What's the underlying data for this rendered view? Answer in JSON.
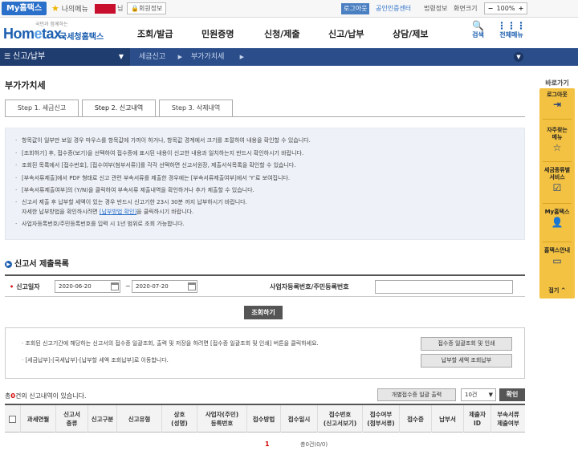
{
  "util": {
    "home_tab": "My홈택스",
    "mymenu": "나의메뉴",
    "nim": "님",
    "member_info": "회원정보",
    "logout": "로그아웃",
    "cert_center": "공인인증센터",
    "law_info": "법령정보",
    "screen_size": "화면크기",
    "zoom_minus": "−",
    "zoom_value": "100%",
    "zoom_plus": "+"
  },
  "header": {
    "logo_tagline": "국민과 함께하는",
    "logo_text_a": "Hom",
    "logo_text_b": "e",
    "logo_text_c": "tax.",
    "logo_agency": "국세청홈택스",
    "nav": [
      "조회/발급",
      "민원증명",
      "신청/제출",
      "신고/납부",
      "상담/제보"
    ],
    "search": "검색",
    "all_menu": "전체메뉴"
  },
  "navbar": {
    "current": "신고/납부",
    "crumb1": "세금신고",
    "crumb2": "부가가치세"
  },
  "page": {
    "title": "부가가치세",
    "tabs": [
      "Step 1. 세금신고",
      "Step 2. 신고내역",
      "Step 3. 삭제내역"
    ],
    "active_tab": 1
  },
  "notice": {
    "lines": [
      "항목값이 일부만 보일 경우 마우스를 항목값에 가까이 하거나, 항목값 경계에서 크기를 조절하여 내용을 확인할 수 있습니다.",
      "[조회하기] 후, 접수증(보기)을 선택하여 접수증에 표시된 내용이 신고한 내용과 일치하는지 반드시 확인하시기 바랍니다.",
      "조회된 목록에서 [접수번호], [접수여부(첨부서류)]를 각각 선택하면 신고서원장, 제출서식목록을 확인할 수 있습니다.",
      "[부속서류제출]에서 PDF 형태로 신고 관련 부속서류를 제출한 경우에는 [부속서류제출여부]에서 'Y'로 보여집니다.",
      "[부속서류제출여부]의 (Y/N)을 클릭하여 부속서류 제출내역을 확인하거나 추가 제출할 수 있습니다.",
      "신고서 제출 후 납부할 세액이 있는 경우 반드시 신고기한 23시 30분 까지 납부하시기 바랍니다."
    ],
    "cont_prefix": "자세한 납부방법을 확인하시려면 ",
    "cont_link": "[납부방법 확인]",
    "cont_suffix": "을 클릭하시기 바랍니다.",
    "last_line": "사업자등록번호/주민등록번호를 입력 시 1년 범위로 조회 가능합니다."
  },
  "section": {
    "title": "신고서 제출목록"
  },
  "search": {
    "date_label": "신고일자",
    "date_from": "2020-06-20",
    "date_to": "2020-07-20",
    "tilde": "~",
    "biz_label": "사업자등록번호/주민등록번호",
    "biz_value": "",
    "query_button": "조회하기"
  },
  "notice2": {
    "line1": "· 조회된 신고기간에 해당하는 신고서의 접수증 일괄조회, 출력 및 저장을 하려면 [접수증 일괄조회 및 인쇄] 버튼을 클릭하세요.",
    "line2": "· [세금납부]-[국세납부]-[납부할 세액 조회납부]로 이동합니다.",
    "btn1": "접수증 일괄조회 및 인쇄",
    "btn2": "납부할 세액 조회납부"
  },
  "list": {
    "count_prefix": "총",
    "count": "0",
    "count_suffix": "건의 신고내역이 있습니다.",
    "batch_print": "개별접수증 일괄 출력",
    "page_size": "10건",
    "confirm": "확인",
    "columns": [
      [
        "과세연월"
      ],
      [
        "신고서",
        "종류"
      ],
      [
        "신고구분"
      ],
      [
        "신고유형"
      ],
      [
        "상호",
        "(성명)"
      ],
      [
        "사업자(주민)",
        "등록번호"
      ],
      [
        "접수방법"
      ],
      [
        "접수일시"
      ],
      [
        "접수번호",
        "(신고서보기)"
      ],
      [
        "접수여부",
        "(첨부서류)"
      ],
      [
        "접수증"
      ],
      [
        "납부서"
      ],
      [
        "제출자",
        "ID"
      ],
      [
        "부속서류",
        "제출여부"
      ]
    ]
  },
  "pager": {
    "page": "1",
    "total": "총0건(0/0)"
  },
  "quick": {
    "title": "바로가기",
    "items": [
      {
        "label": "로그아웃",
        "icon": "logout-icon",
        "glyph": "⇥"
      },
      {
        "label": "자주찾는 메뉴",
        "icon": "star-icon",
        "glyph": "☆"
      },
      {
        "label": "세금종류별 서비스",
        "icon": "checklist-icon",
        "glyph": "☑"
      },
      {
        "label": "My홈택스",
        "icon": "person-icon",
        "glyph": "👤"
      },
      {
        "label": "홈택스안내",
        "icon": "monitor-icon",
        "glyph": "▭"
      }
    ],
    "collapse": "접기 ^"
  },
  "colors": {
    "primary": "#1d5fb0",
    "nav_bar": "#2b4e8a",
    "quick_bar": "#f4c242",
    "notice_bg": "#eef2f8",
    "required": "#d40000"
  }
}
